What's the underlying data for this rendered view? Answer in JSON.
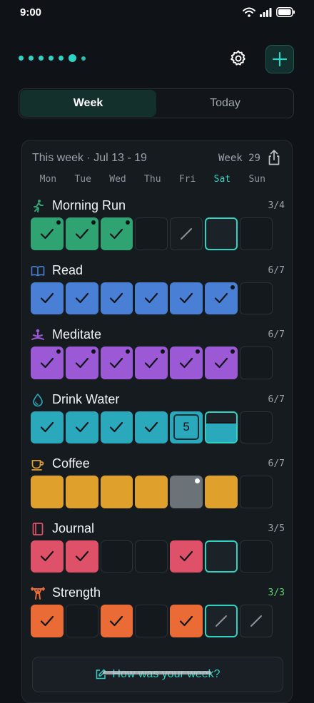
{
  "status": {
    "time": "9:00"
  },
  "tabs": [
    {
      "label": "Week",
      "active": true
    },
    {
      "label": "Today",
      "active": false
    }
  ],
  "week": {
    "range": "This week · Jul 13 - 19",
    "number": "Week 29",
    "days": [
      "Mon",
      "Tue",
      "Wed",
      "Thu",
      "Fri",
      "Sat",
      "Sun"
    ],
    "today_index": 5
  },
  "colors": {
    "accent": "#2fd3c3",
    "run": "#2fa372",
    "read": "#4a7fd6",
    "meditate": "#9b59d6",
    "water": "#2aa9bd",
    "coffee": "#e0a02c",
    "journal": "#df5168",
    "strength": "#ea6b35",
    "grey": "#6b7378"
  },
  "habits": [
    {
      "name": "Morning Run",
      "icon": "running-icon",
      "count": "3/4",
      "color": "run",
      "cells": [
        "check-dot",
        "check-dot",
        "check-dot",
        "empty",
        "skip",
        "today",
        "empty"
      ]
    },
    {
      "name": "Read",
      "icon": "book-icon",
      "count": "6/7",
      "color": "read",
      "cells": [
        "check",
        "check",
        "check",
        "check",
        "check",
        "check-dot",
        "empty"
      ]
    },
    {
      "name": "Meditate",
      "icon": "meditation-icon",
      "count": "6/7",
      "color": "meditate",
      "cells": [
        "check-dot",
        "check-dot",
        "check-dot",
        "check-dot",
        "check-dot",
        "check-dot",
        "empty"
      ]
    },
    {
      "name": "Drink Water",
      "icon": "water-drop-icon",
      "count": "6/7",
      "color": "water",
      "cells": [
        "check",
        "check",
        "check",
        "check",
        "number",
        "water-half",
        "empty"
      ],
      "number": "5"
    },
    {
      "name": "Coffee",
      "icon": "coffee-cup-icon",
      "count": "6/7",
      "color": "coffee",
      "cells": [
        "fill",
        "fill",
        "fill",
        "fill",
        "grey-dot",
        "fill",
        "empty"
      ]
    },
    {
      "name": "Journal",
      "icon": "journal-icon",
      "count": "3/5",
      "color": "journal",
      "cells": [
        "check",
        "check",
        "empty",
        "empty",
        "check",
        "today",
        "empty"
      ]
    },
    {
      "name": "Strength",
      "icon": "weightlifter-icon",
      "count": "3/3",
      "color": "strength",
      "complete": true,
      "cells": [
        "check",
        "empty",
        "check",
        "empty",
        "check",
        "today-skip",
        "skip"
      ]
    }
  ],
  "reflect": {
    "label": "How was your week?"
  }
}
